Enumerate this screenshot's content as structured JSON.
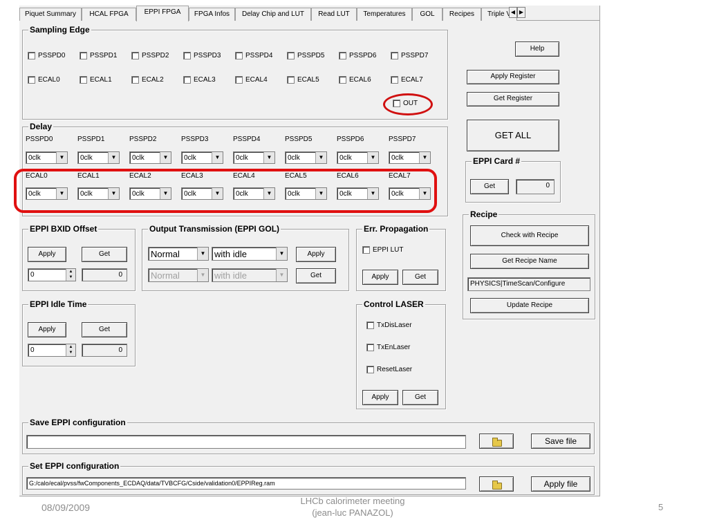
{
  "tabs": [
    "Piquet Summary",
    "HCAL FPGA",
    "EPPI FPGA",
    "FPGA Infos",
    "Delay Chip and LUT",
    "Read LUT",
    "Temperatures",
    "GOL",
    "Recipes",
    "Triple V"
  ],
  "active_tab": "EPPI FPGA",
  "scroll": {
    "left": "◀",
    "right": "▶"
  },
  "sampling_edge": {
    "title": "Sampling Edge",
    "row1": [
      "PSSPD0",
      "PSSPD1",
      "PSSPD2",
      "PSSPD3",
      "PSSPD4",
      "PSSPD5",
      "PSSPD6",
      "PSSPD7"
    ],
    "row2": [
      "ECAL0",
      "ECAL1",
      "ECAL2",
      "ECAL3",
      "ECAL4",
      "ECAL5",
      "ECAL6",
      "ECAL7"
    ],
    "out_label": "OUT"
  },
  "delay": {
    "title": "Delay",
    "row1_labels": [
      "PSSPD0",
      "PSSPD1",
      "PSSPD2",
      "PSSPD3",
      "PSSPD4",
      "PSSPD5",
      "PSSPD6",
      "PSSPD7"
    ],
    "row2_labels": [
      "ECAL0",
      "ECAL1",
      "ECAL2",
      "ECAL3",
      "ECAL4",
      "ECAL5",
      "ECAL6",
      "ECAL7"
    ],
    "combo_value": "0clk"
  },
  "right_panel": {
    "help": "Help",
    "apply_register": "Apply Register",
    "get_register": "Get Register",
    "get_all": "GET ALL",
    "card_title": "EPPI Card #",
    "card_get": "Get",
    "card_value": "0"
  },
  "recipe": {
    "title": "Recipe",
    "check": "Check with Recipe",
    "get_name": "Get Recipe Name",
    "name_value": "PHYSICS|TimeScan/Configure",
    "update": "Update Recipe"
  },
  "bxid": {
    "title": "EPPI BXID Offset",
    "apply": "Apply",
    "get": "Get",
    "spin_value": "0",
    "value": "0"
  },
  "idle": {
    "title": "EPPI Idle Time",
    "apply": "Apply",
    "get": "Get",
    "spin_value": "0",
    "value": "0"
  },
  "output": {
    "title": "Output Transmission (EPPI GOL)",
    "mode": "Normal",
    "idle": "with idle",
    "mode_read": "Normal",
    "idle_read": "with idle",
    "apply": "Apply",
    "get": "Get"
  },
  "err": {
    "title": "Err. Propagation",
    "lut": "EPPI LUT",
    "apply": "Apply",
    "get": "Get"
  },
  "laser": {
    "title": "Control LASER",
    "items": [
      "TxDisLaser",
      "TxEnLaser",
      "ResetLaser"
    ],
    "apply": "Apply",
    "get": "Get"
  },
  "save_cfg": {
    "title": "Save EPPI configuration",
    "path": "",
    "button": "Save file"
  },
  "set_cfg": {
    "title": "Set EPPI configuration",
    "path": "G:/calo/ecal/pvss/fwComponents_ECDAQ/data/TVBCFG/Cside/validation0/EPPIReg.ram",
    "button": "Apply file"
  },
  "footer": {
    "date": "08/09/2009",
    "line1": "LHCb calorimeter meeting",
    "line2": "(jean-luc PANAZOL)",
    "page": "5"
  },
  "colors": {
    "annotation": "#e01010",
    "window": "#f0f0f0",
    "footer_text": "#8c8c8c"
  }
}
